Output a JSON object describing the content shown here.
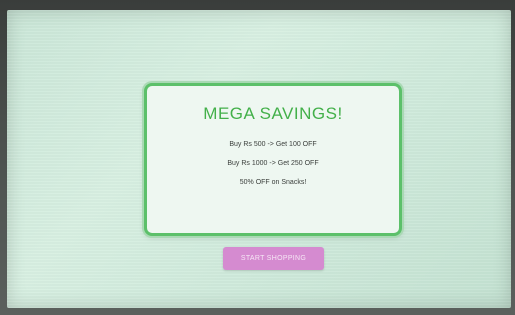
{
  "promo": {
    "title": "MEGA SAVINGS!",
    "offers": [
      "Buy Rs 500  -> Get 100 OFF",
      "Buy Rs 1000 -> Get 250 OFF",
      "50% OFF on Snacks!"
    ]
  },
  "actions": {
    "start_shopping_label": "START SHOPPING"
  },
  "colors": {
    "accent_green": "#43b04a",
    "button_pink": "#d58bd0",
    "screen_background": "#d8f0e2"
  }
}
